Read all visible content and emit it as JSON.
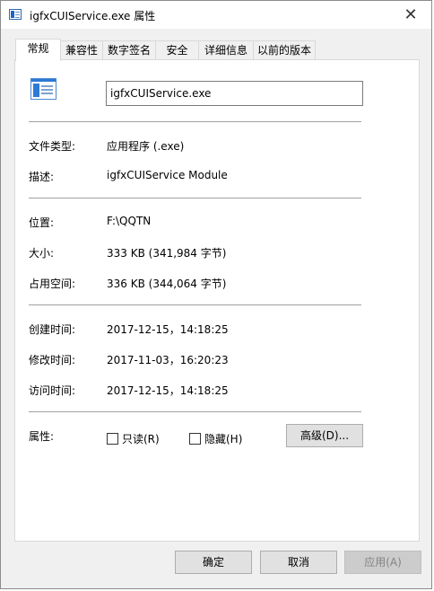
{
  "window": {
    "title": "igfxCUIService.exe 属性",
    "close_glyph": "✕"
  },
  "tabs": [
    {
      "label": "常规",
      "active": true
    },
    {
      "label": "兼容性"
    },
    {
      "label": "数字签名"
    },
    {
      "label": "安全"
    },
    {
      "label": "详细信息"
    },
    {
      "label": "以前的版本"
    }
  ],
  "general": {
    "file_name": "igfxCUIService.exe",
    "type_label": "文件类型:",
    "type_value": "应用程序 (.exe)",
    "desc_label": "描述:",
    "desc_value": "igfxCUIService Module",
    "location_label": "位置:",
    "location_value": "F:\\QQTN",
    "size_label": "大小:",
    "size_value": "333 KB (341,984 字节)",
    "disk_label": "占用空间:",
    "disk_value": "336 KB (344,064 字节)",
    "created_label": "创建时间:",
    "created_value": "2017-12-15，14:18:25",
    "modified_label": "修改时间:",
    "modified_value": "2017-11-03，16:20:23",
    "accessed_label": "访问时间:",
    "accessed_value": "2017-12-15，14:18:25",
    "attr_label": "属性:",
    "readonly_label": "只读(R)",
    "hidden_label": "隐藏(H)",
    "advanced_label": "高级(D)..."
  },
  "footer": {
    "ok_label": "确定",
    "cancel_label": "取消",
    "apply_label": "应用(A)"
  }
}
